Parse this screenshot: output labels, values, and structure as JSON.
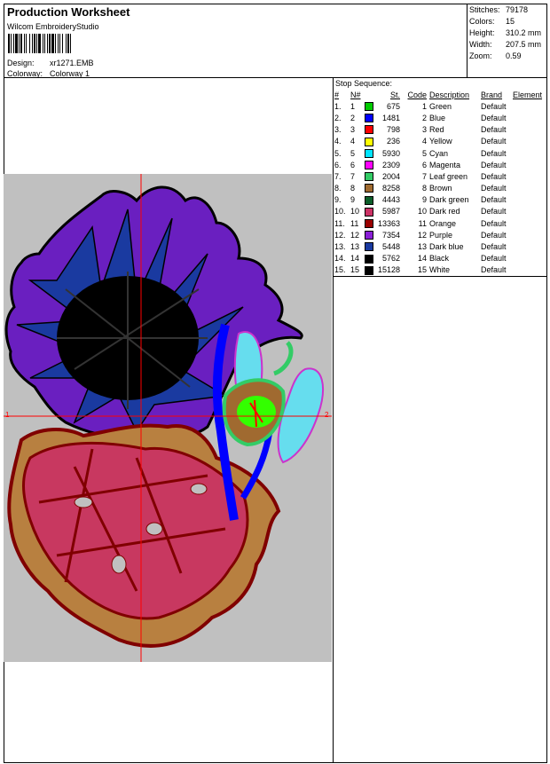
{
  "header": {
    "title": "Production Worksheet",
    "software": "Wilcom EmbroideryStudio",
    "design_label": "Design:",
    "design_value": "xr1271.EMB",
    "colorway_label": "Colorway:",
    "colorway_value": "Colorway 1"
  },
  "stats": [
    {
      "label": "Stitches:",
      "value": "79178"
    },
    {
      "label": "Colors:",
      "value": "15"
    },
    {
      "label": "Height:",
      "value": "310.2 mm"
    },
    {
      "label": "Width:",
      "value": "207.5 mm"
    },
    {
      "label": "Zoom:",
      "value": "0.59"
    }
  ],
  "stop_sequence": {
    "title": "Stop Sequence:",
    "columns": [
      "#",
      "N#",
      "St.",
      "Code",
      "Description",
      "Brand",
      "Element"
    ],
    "rows": [
      {
        "num": "1.",
        "n": "1",
        "color": "#00cc00",
        "st": "675",
        "code": "1",
        "desc": "Green",
        "brand": "Default"
      },
      {
        "num": "2.",
        "n": "2",
        "color": "#0000ff",
        "st": "1481",
        "code": "2",
        "desc": "Blue",
        "brand": "Default"
      },
      {
        "num": "3.",
        "n": "3",
        "color": "#ff0000",
        "st": "798",
        "code": "3",
        "desc": "Red",
        "brand": "Default"
      },
      {
        "num": "4.",
        "n": "4",
        "color": "#ffff00",
        "st": "236",
        "code": "4",
        "desc": "Yellow",
        "brand": "Default"
      },
      {
        "num": "5.",
        "n": "5",
        "color": "#00e5ff",
        "st": "5930",
        "code": "5",
        "desc": "Cyan",
        "brand": "Default"
      },
      {
        "num": "6.",
        "n": "6",
        "color": "#ff00ff",
        "st": "2309",
        "code": "6",
        "desc": "Magenta",
        "brand": "Default"
      },
      {
        "num": "7.",
        "n": "7",
        "color": "#33cc66",
        "st": "2004",
        "code": "7",
        "desc": "Leaf green",
        "brand": "Default"
      },
      {
        "num": "8.",
        "n": "8",
        "color": "#a06a30",
        "st": "8258",
        "code": "8",
        "desc": "Brown",
        "brand": "Default"
      },
      {
        "num": "9.",
        "n": "9",
        "color": "#0b5e2a",
        "st": "4443",
        "code": "9",
        "desc": "Dark green",
        "brand": "Default"
      },
      {
        "num": "10.",
        "n": "10",
        "color": "#cc3366",
        "st": "5987",
        "code": "10",
        "desc": "Dark red",
        "brand": "Default"
      },
      {
        "num": "11.",
        "n": "11",
        "color": "#990000",
        "st": "13363",
        "code": "11",
        "desc": "Orange",
        "brand": "Default"
      },
      {
        "num": "12.",
        "n": "12",
        "color": "#8a1fd6",
        "st": "7354",
        "code": "12",
        "desc": "Purple",
        "brand": "Default"
      },
      {
        "num": "13.",
        "n": "13",
        "color": "#1a3aa0",
        "st": "5448",
        "code": "13",
        "desc": "Dark blue",
        "brand": "Default"
      },
      {
        "num": "14.",
        "n": "14",
        "color": "#000000",
        "st": "5762",
        "code": "14",
        "desc": "Black",
        "brand": "Default"
      },
      {
        "num": "15.",
        "n": "15",
        "color": "#000000",
        "st": "15128",
        "code": "15",
        "desc": "White",
        "brand": "Default"
      }
    ]
  },
  "preview": {
    "axis_left_label": "1",
    "axis_right_label": "2",
    "background": "#c0c0c0",
    "crosshair_color": "#ff0000"
  }
}
